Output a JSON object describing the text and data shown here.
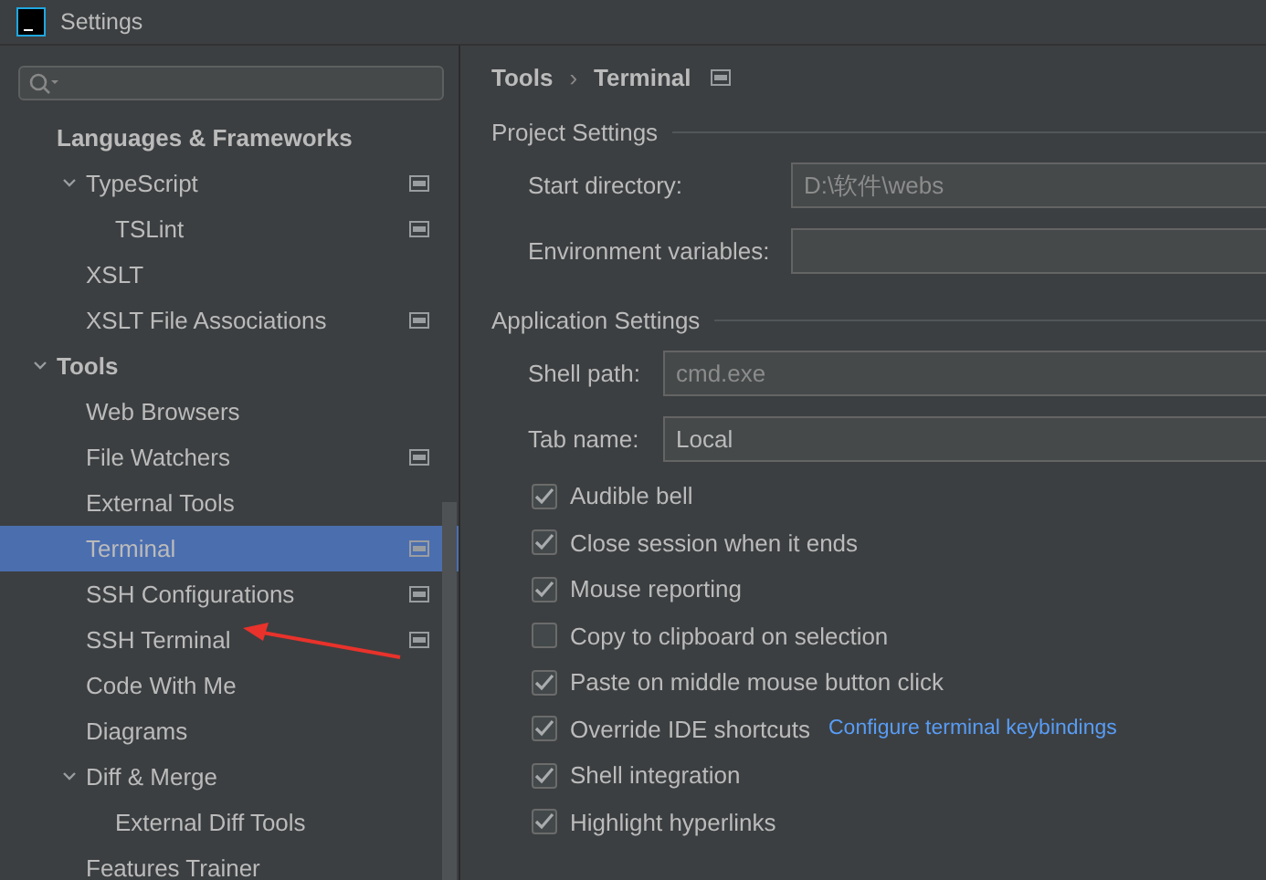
{
  "window": {
    "title": "Settings"
  },
  "sidebar": {
    "items": [
      {
        "label": "Languages & Frameworks",
        "kind": "header",
        "children": [
          {
            "label": "TypeScript",
            "expanded": true,
            "project_level": true,
            "selected": false,
            "children": [
              {
                "label": "TSLint",
                "project_level": true,
                "selected": false
              }
            ]
          },
          {
            "label": "XSLT",
            "project_level": false,
            "selected": false
          },
          {
            "label": "XSLT File Associations",
            "project_level": true,
            "selected": false
          }
        ]
      },
      {
        "label": "Tools",
        "kind": "group",
        "expanded": true,
        "children": [
          {
            "label": "Web Browsers",
            "project_level": false,
            "selected": false
          },
          {
            "label": "File Watchers",
            "project_level": true,
            "selected": false
          },
          {
            "label": "External Tools",
            "project_level": false,
            "selected": false
          },
          {
            "label": "Terminal",
            "project_level": true,
            "selected": true
          },
          {
            "label": "SSH Configurations",
            "project_level": true,
            "selected": false
          },
          {
            "label": "SSH Terminal",
            "project_level": true,
            "selected": false
          },
          {
            "label": "Code With Me",
            "project_level": false,
            "selected": false
          },
          {
            "label": "Diagrams",
            "project_level": false,
            "selected": false
          },
          {
            "label": "Diff & Merge",
            "expanded": true,
            "project_level": false,
            "selected": false,
            "children": [
              {
                "label": "External Diff Tools",
                "project_level": false,
                "selected": false
              }
            ]
          },
          {
            "label": "Features Trainer",
            "project_level": false,
            "selected": false
          }
        ]
      }
    ]
  },
  "breadcrumb": {
    "items": [
      "Tools",
      "Terminal"
    ],
    "separator": "›",
    "project_level": true
  },
  "sections": [
    {
      "title": "Project Settings",
      "fields": [
        {
          "label": "Start directory:",
          "value": "D:\\软件\\webs",
          "placeholder_style": true
        },
        {
          "label": "Environment variables:"
        }
      ]
    },
    {
      "title": "Application Settings",
      "fields": [
        {
          "label": "Shell path:",
          "value": "cmd.exe",
          "placeholder_style": true
        },
        {
          "label": "Tab name:",
          "value": "Local",
          "placeholder_style": false
        }
      ]
    }
  ],
  "options": [
    {
      "label": "Audible bell",
      "checked": true
    },
    {
      "label": "Close session when it ends",
      "checked": true
    },
    {
      "label": "Mouse reporting",
      "checked": true
    },
    {
      "label": "Copy to clipboard on selection",
      "checked": false
    },
    {
      "label": "Paste on middle mouse button click",
      "checked": true
    },
    {
      "label": "Override IDE shortcuts",
      "checked": true,
      "link": "Configure terminal keybindings"
    },
    {
      "label": "Shell integration",
      "checked": true
    },
    {
      "label": "Highlight hyperlinks",
      "checked": true
    }
  ]
}
